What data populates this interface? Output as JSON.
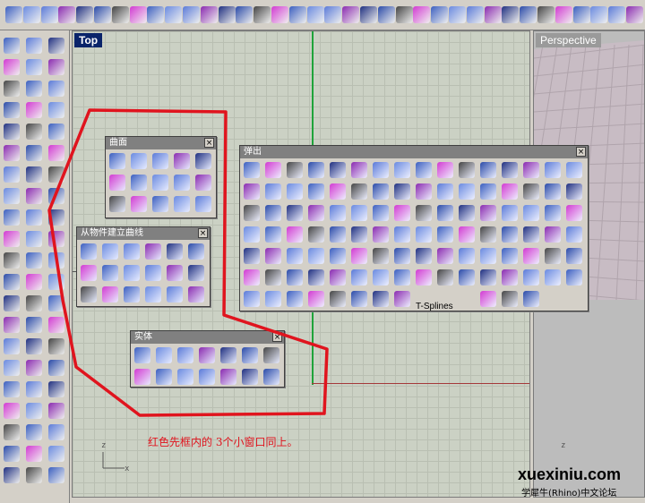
{
  "viewports": {
    "top_label": "Top",
    "perspective_label": "Perspective",
    "gizmo_top_z": "z",
    "gizmo_top_x": "x",
    "gizmo_persp_z": "z"
  },
  "panels": {
    "surface": {
      "title": "曲面",
      "close": "×"
    },
    "curve_from_object": {
      "title": "从物件建立曲线",
      "close": "×"
    },
    "solid": {
      "title": "实体",
      "close": "×"
    },
    "popup": {
      "title": "弹出",
      "close": "×",
      "tsplines_label": "T-Splines"
    }
  },
  "annotation": "红色先框内的 3个小窗口同上。",
  "watermark": {
    "site": "xuexiniu.com",
    "subtitle": "学犀牛(Rhino)中文论坛"
  },
  "colors": {
    "active_viewport_label": "#0a246a",
    "grid_background": "#cbd1c4",
    "annotation_red": "#e0141e",
    "icon_blue": "#3b5fc0",
    "icon_magenta": "#d23ad2"
  }
}
